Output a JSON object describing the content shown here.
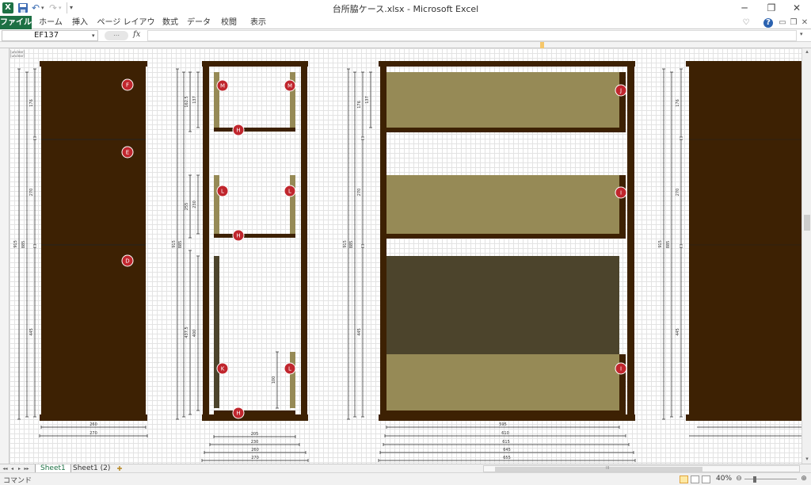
{
  "window": {
    "title": "台所脇ケース.xlsx - Microsoft Excel",
    "app_icon": "excel-icon",
    "minimize_glyph": "─",
    "restore_glyph": "❐",
    "close_glyph": "✕"
  },
  "quick_access": {
    "save_icon": "save-icon",
    "undo_glyph": "↶",
    "redo_glyph": "↷",
    "dropdown_glyph": "▾",
    "customize_glyph": "▾"
  },
  "ribbon": {
    "tabs": [
      {
        "label": "ファイル"
      },
      {
        "label": "ホーム"
      },
      {
        "label": "挿入"
      },
      {
        "label": "ページ レイアウト"
      },
      {
        "label": "数式"
      },
      {
        "label": "データ"
      },
      {
        "label": "校閲"
      },
      {
        "label": "表示"
      }
    ],
    "collapse_glyph": "♡",
    "help_glyph": "?",
    "wb_min_glyph": "▭",
    "wb_restore_glyph": "❐",
    "wb_close_glyph": "✕"
  },
  "formula_bar": {
    "name_box": "EF137",
    "name_drop_glyph": "▾",
    "fx_label": "fx",
    "expand_glyph": "⋯",
    "formula": "",
    "expand_right_glyph": "▾"
  },
  "sheet": {
    "cell_tags": [
      "[unclear]",
      "[unclear]"
    ],
    "scroll_up_glyph": "▴",
    "scroll_down_glyph": "▾",
    "drawing": {
      "colors": {
        "panel": "#3d2103",
        "frame": "#3d2103",
        "drawer_front": "#968a56",
        "drawer_dark": "#4c442c",
        "marker": "#c0262d",
        "dim_line": "#222222"
      },
      "markers": [
        "F",
        "E",
        "D",
        "M",
        "M",
        "H",
        "L",
        "L",
        "H",
        "K",
        "L",
        "H",
        "J",
        "I",
        "I"
      ],
      "dims": {
        "front_heights": [
          "176",
          "270",
          "445"
        ],
        "front_totals": [
          "915",
          "885"
        ],
        "front_widths": [
          "260",
          "270"
        ],
        "side_heights": [
          "162.5",
          "137",
          "255",
          "230",
          "437.5",
          "400",
          "100"
        ],
        "side_totals": [
          "915",
          "885"
        ],
        "side_widths": [
          "205",
          "230",
          "260",
          "270"
        ],
        "back_heights": [
          "176",
          "137",
          "270",
          "445"
        ],
        "back_totals": [
          "915",
          "885"
        ],
        "back_widths": [
          "595",
          "610",
          "615",
          "645",
          "655"
        ],
        "far_heights": [
          "176",
          "270",
          "445"
        ],
        "far_totals": [
          "915",
          "885"
        ]
      }
    }
  },
  "sheet_tabs": {
    "nav": [
      "◂◂",
      "◂",
      "▸",
      "▸▸"
    ],
    "tabs": [
      "Sheet1",
      "Sheet1 (2)"
    ],
    "new_sheet_glyph": "✚",
    "hscroll_grip": "III"
  },
  "status_bar": {
    "mode": "コマンド",
    "zoom": "40%",
    "zoom_out_glyph": "⊖",
    "zoom_in_glyph": "⊕",
    "zoom_fraction": 0.4
  }
}
